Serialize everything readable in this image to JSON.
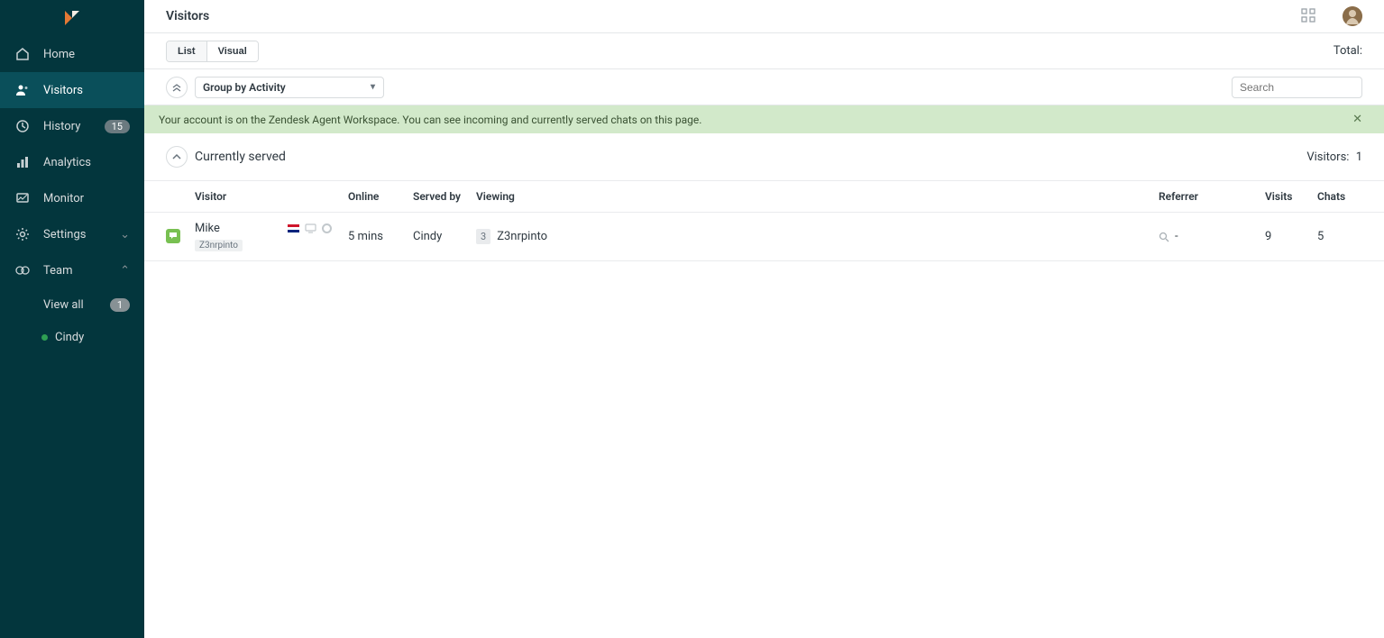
{
  "sidebar": {
    "items": [
      {
        "label": "Home"
      },
      {
        "label": "Visitors"
      },
      {
        "label": "History",
        "badge": "15"
      },
      {
        "label": "Analytics"
      },
      {
        "label": "Monitor"
      },
      {
        "label": "Settings"
      },
      {
        "label": "Team"
      }
    ],
    "team_sub": {
      "view_all": {
        "label": "View all",
        "badge": "1"
      },
      "agents": [
        {
          "name": "Cindy"
        }
      ]
    }
  },
  "header": {
    "title": "Visitors"
  },
  "toolbar": {
    "tabs": {
      "list": "List",
      "visual": "Visual"
    },
    "total_label": "Total:"
  },
  "controls": {
    "group_label": "Group by Activity",
    "search_placeholder": "Search"
  },
  "banner": {
    "message": "Your account is on the Zendesk Agent Workspace. You can see incoming and currently served chats on this page."
  },
  "section": {
    "title": "Currently served",
    "stat_label": "Visitors:",
    "stat_count": "1"
  },
  "columns": {
    "visitor": "Visitor",
    "online": "Online",
    "served_by": "Served by",
    "viewing": "Viewing",
    "referrer": "Referrer",
    "visits": "Visits",
    "chats": "Chats"
  },
  "rows": [
    {
      "name": "Mike",
      "sub": "Z3nrpinto",
      "online": "5 mins",
      "served_by": "Cindy",
      "page_count": "3",
      "viewing": "Z3nrpinto",
      "referrer": "-",
      "visits": "9",
      "chats": "5"
    }
  ]
}
